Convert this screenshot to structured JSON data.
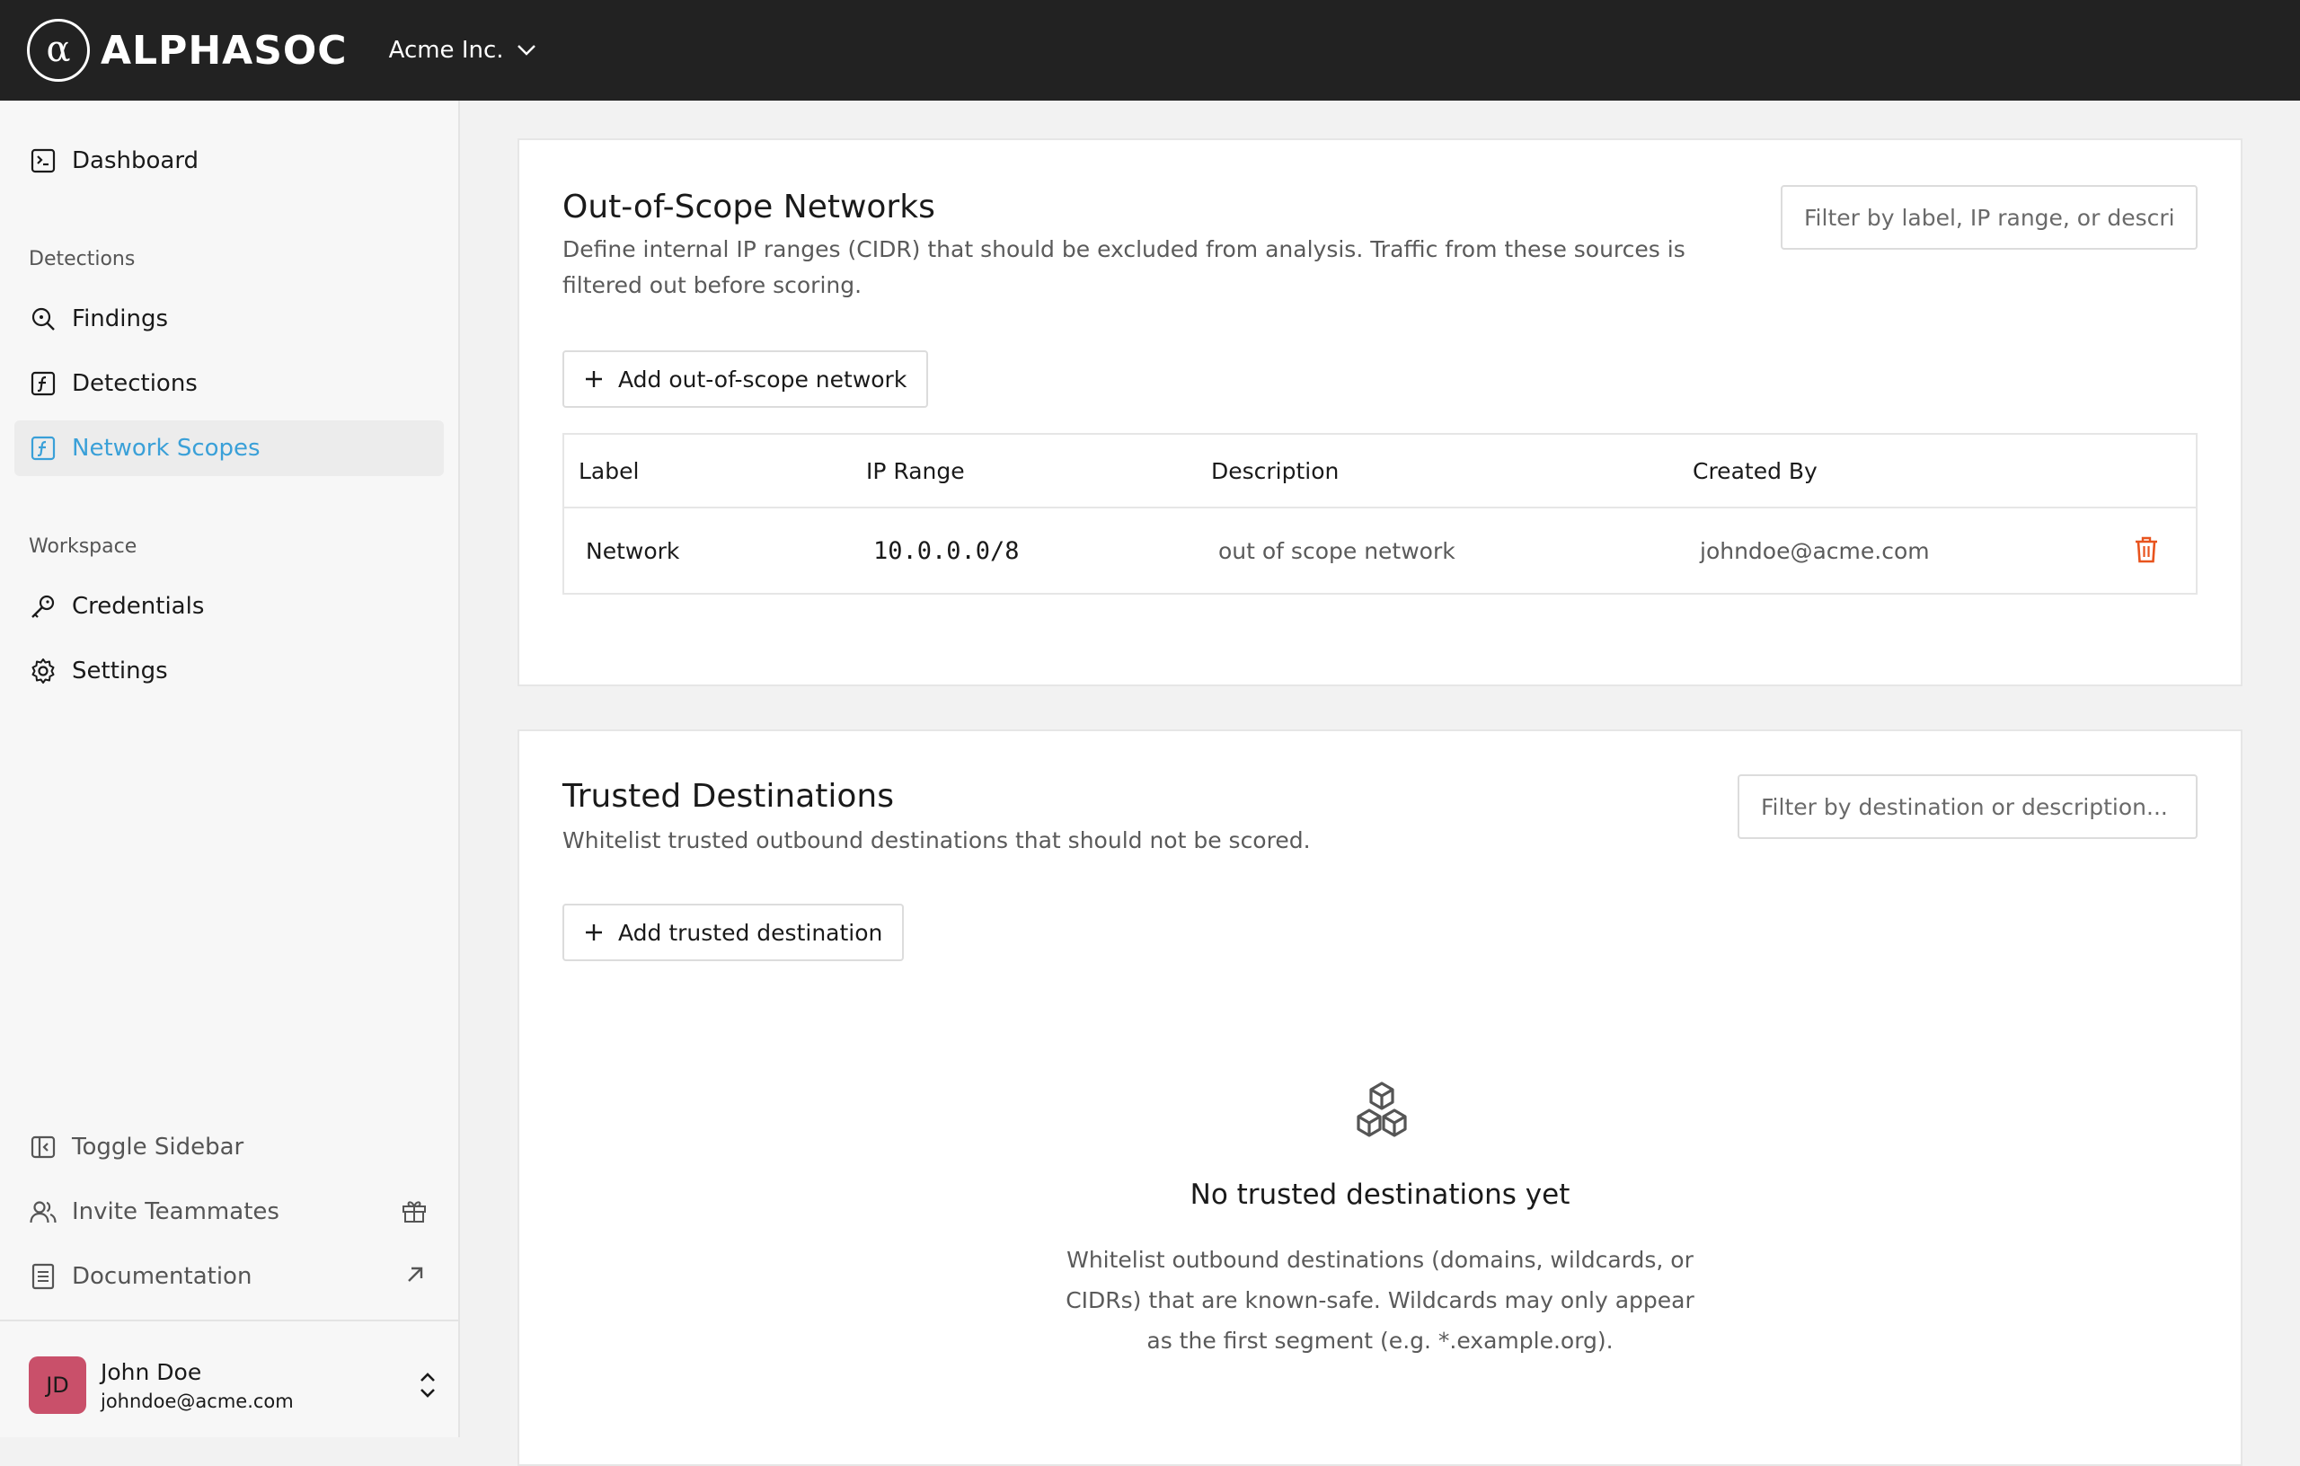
{
  "brand": {
    "name": "ALPHASOC",
    "mark": "α"
  },
  "org_switcher": {
    "label": "Acme Inc."
  },
  "sidebar": {
    "dashboard": "Dashboard",
    "sections": {
      "detections": "Detections",
      "workspace": "Workspace"
    },
    "detection_items": [
      {
        "label": "Findings",
        "icon": "search-icon"
      },
      {
        "label": "Detections",
        "icon": "function-icon"
      },
      {
        "label": "Network Scopes",
        "icon": "function-icon",
        "active": true
      }
    ],
    "workspace_items": [
      {
        "label": "Credentials",
        "icon": "key-icon"
      },
      {
        "label": "Settings",
        "icon": "gear-icon"
      }
    ],
    "footer_items": [
      {
        "label": "Toggle Sidebar",
        "icon": "sidebar-toggle-icon"
      },
      {
        "label": "Invite Teammates",
        "icon": "users-icon",
        "trail_icon": "gift-icon"
      },
      {
        "label": "Documentation",
        "icon": "document-icon",
        "trail_icon": "external-link-icon"
      }
    ],
    "user": {
      "initials": "JD",
      "name": "John Doe",
      "email": "johndoe@acme.com"
    }
  },
  "out_of_scope": {
    "title": "Out-of-Scope Networks",
    "description": "Define internal IP ranges (CIDR) that should be excluded from analysis. Traffic from these sources is filtered out before scoring.",
    "filter_placeholder": "Filter by label, IP range, or description...",
    "add_button": "Add out-of-scope network",
    "table": {
      "headers": [
        "Label",
        "IP Range",
        "Description",
        "Created By"
      ],
      "rows": [
        {
          "label": "Network",
          "ip_range": "10.0.0.0/8",
          "description": "out of scope network",
          "created_by": "johndoe@acme.com"
        }
      ]
    }
  },
  "trusted": {
    "title": "Trusted Destinations",
    "description": "Whitelist trusted outbound destinations that should not be scored.",
    "filter_placeholder": "Filter by destination or description...",
    "add_button": "Add trusted destination",
    "empty_title": "No trusted destinations yet",
    "empty_text": "Whitelist outbound destinations (domains, wildcards, or CIDRs) that are known-safe. Wildcards may only appear as the first segment (e.g. *.example.org)."
  },
  "colors": {
    "topbar": "#222222",
    "accent": "#3aa0d8",
    "danger": "#e8541e",
    "avatar": "#c9506a"
  }
}
